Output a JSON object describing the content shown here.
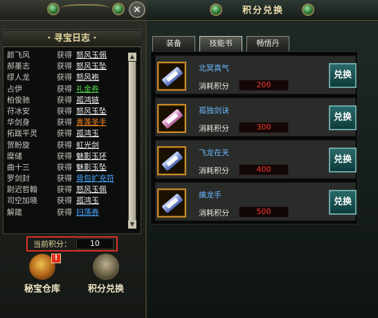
{
  "left_panel": {
    "close_label": "×",
    "log_title": "· 寻宝日志 ·",
    "log_entries": [
      {
        "name": "颜飞风",
        "verb": "获得",
        "item": "怒风玉佩",
        "color": "white"
      },
      {
        "name": "郝墨志",
        "verb": "获得",
        "item": "怒风玉坠",
        "color": "white"
      },
      {
        "name": "缪人龙",
        "verb": "获得",
        "item": "怒风袍",
        "color": "white"
      },
      {
        "name": "占伊",
        "verb": "获得",
        "item": "礼金券",
        "color": "green"
      },
      {
        "name": "柏俊驰",
        "verb": "获得",
        "item": "孤鸿链",
        "color": "white"
      },
      {
        "name": "苻冰安",
        "verb": "获得",
        "item": "怒风玉坠",
        "color": "white"
      },
      {
        "name": "华剑身",
        "verb": "获得",
        "item": "青莲圣手",
        "color": "orange"
      },
      {
        "name": "拓跋平灵",
        "verb": "获得",
        "item": "孤鸿玉",
        "color": "white"
      },
      {
        "name": "贺盼旋",
        "verb": "获得",
        "item": "虹光剑",
        "color": "white"
      },
      {
        "name": "糜储",
        "verb": "获得",
        "item": "魅影玉环",
        "color": "white"
      },
      {
        "name": "曲十三",
        "verb": "获得",
        "item": "魅影玉坠",
        "color": "white"
      },
      {
        "name": "罗剑封",
        "verb": "获得",
        "item": "背包扩充符",
        "color": "blue"
      },
      {
        "name": "尉迟哲翰",
        "verb": "获得",
        "item": "怒风玉佩",
        "color": "white"
      },
      {
        "name": "司空加晓",
        "verb": "获得",
        "item": "孤鸿玉",
        "color": "white"
      },
      {
        "name": "解箴",
        "verb": "获得",
        "item": "扫荡券",
        "color": "blue"
      }
    ],
    "scroll_up": "▲",
    "scroll_down": "▼",
    "points_label": "当前积分：",
    "points_value": "10",
    "warehouse_label": "秘宝仓库",
    "exchange_label": "积分兑换",
    "alert_badge": "!"
  },
  "right_panel": {
    "title": "积分兑换",
    "tabs": [
      {
        "label": "装备",
        "active": false
      },
      {
        "label": "技能书",
        "active": true
      },
      {
        "label": "畅悟丹",
        "active": false
      }
    ],
    "cost_label": "消耗积分",
    "redeem_label": "兑换",
    "items": [
      {
        "name": "北冥真气",
        "cost": "200",
        "book": "blue"
      },
      {
        "name": "孤独剑诀",
        "cost": "300",
        "book": "pink"
      },
      {
        "name": "飞龙在天",
        "cost": "400",
        "book": "blue"
      },
      {
        "name": "擒龙手",
        "cost": "500",
        "book": "blue"
      }
    ]
  }
}
